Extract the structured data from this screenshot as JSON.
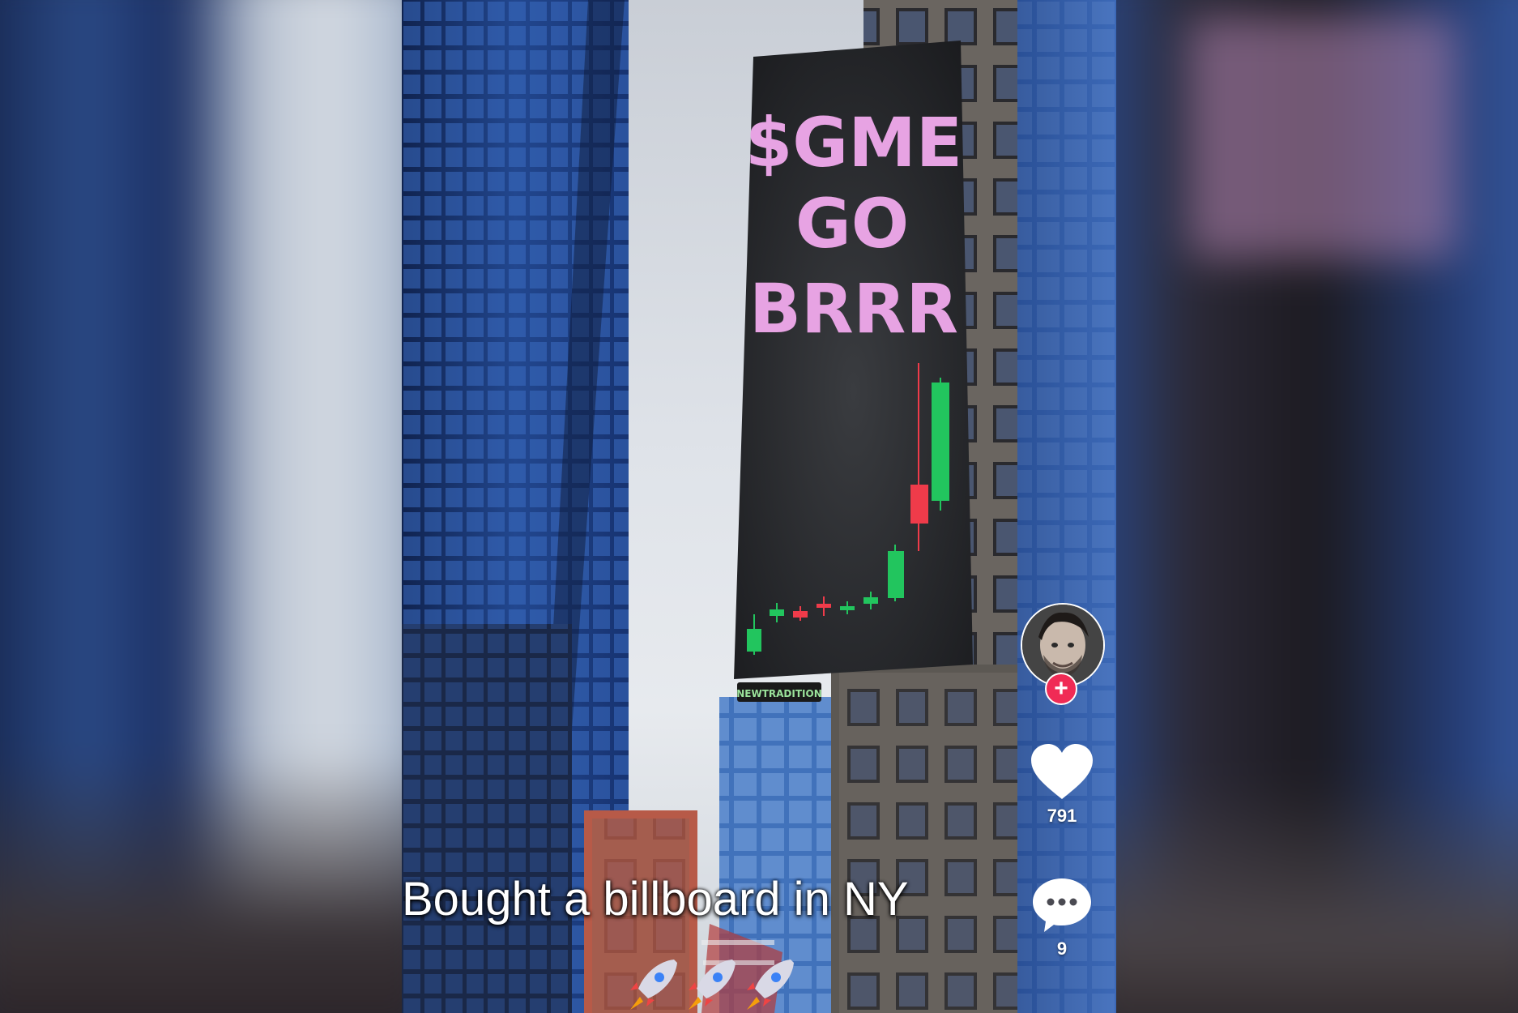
{
  "billboard": {
    "line1": "$GME",
    "line2": "GO",
    "line3": "BRRR",
    "sign_below": "NEWTRADITION"
  },
  "overlay": {
    "caption": "Bought a billboard in NY",
    "likes": "791",
    "comments": "9",
    "follow_symbol": "+"
  },
  "icons": {
    "avatar": "creator-avatar",
    "follow": "plus-icon",
    "like": "heart-icon",
    "comment": "comment-bubble-icon",
    "caption_emoji": "rocket-icon"
  },
  "colors": {
    "billboard_text": "#e7a3e3",
    "candle_up": "#22c55e",
    "candle_down": "#ef3b4a",
    "follow_button": "#f02b55"
  }
}
